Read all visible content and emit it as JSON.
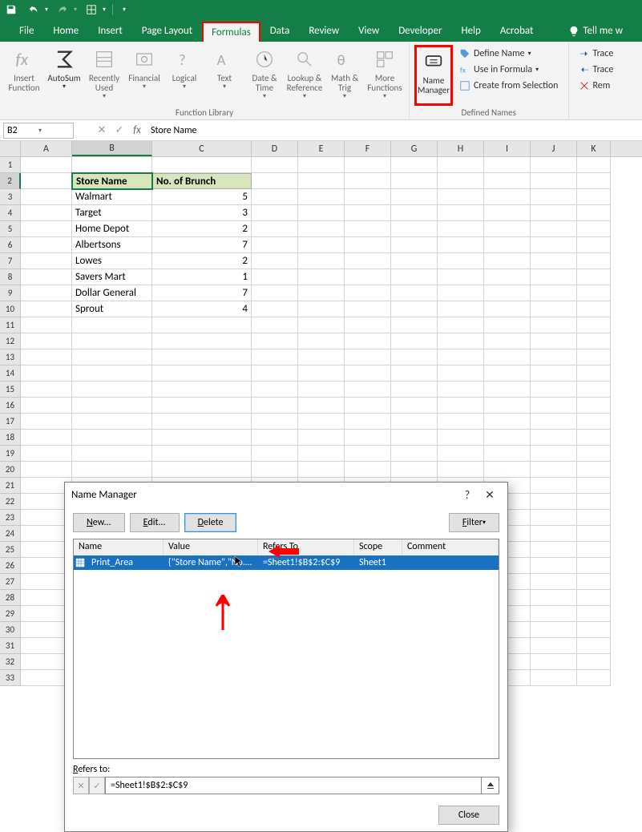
{
  "qat": {
    "save": "save",
    "undo": "undo",
    "redo": "redo",
    "customize": "customize"
  },
  "tabs": [
    "File",
    "Home",
    "Insert",
    "Page Layout",
    "Formulas",
    "Data",
    "Review",
    "View",
    "Developer",
    "Help",
    "Acrobat"
  ],
  "active_tab": "Formulas",
  "tellme": "Tell me w",
  "ribbon": {
    "func_lib_label": "Function Library",
    "insert_function": "Insert\nFunction",
    "autosum": "AutoSum",
    "recently": "Recently\nUsed",
    "financial": "Financial",
    "logical": "Logical",
    "text": "Text",
    "datetime": "Date &\nTime",
    "lookup": "Lookup &\nReference",
    "math": "Math &\nTrig",
    "more": "More\nFunctions",
    "name_manager": "Name\nManager",
    "defined_names_label": "Defined Names",
    "define_name": "Define Name",
    "use_in_formula": "Use in Formula",
    "create_from_selection": "Create from Selection",
    "trace_precedents": "Trace",
    "trace_dependents": "Trace",
    "remove_arrows": "Rem"
  },
  "namebox": "B2",
  "formula_value": "Store Name",
  "columns": [
    "A",
    "B",
    "C",
    "D",
    "E",
    "F",
    "G",
    "H",
    "I",
    "J",
    "K"
  ],
  "rows": [
    1,
    2,
    3,
    4,
    5,
    6,
    7,
    8,
    9,
    10,
    11,
    12,
    13,
    14,
    15,
    16,
    17,
    18,
    19,
    20,
    21,
    22,
    23,
    24,
    25,
    26,
    27,
    28,
    29,
    30,
    31,
    32,
    33
  ],
  "data": {
    "headers": [
      "Store Name",
      "No. of Brunch"
    ],
    "stores": [
      {
        "name": "Walmart",
        "brunch": 5
      },
      {
        "name": "Target",
        "brunch": 3
      },
      {
        "name": "Home Depot",
        "brunch": 2
      },
      {
        "name": "Albertsons",
        "brunch": 7
      },
      {
        "name": "Lowes",
        "brunch": 2
      },
      {
        "name": "Savers Mart",
        "brunch": 1
      },
      {
        "name": "Dollar General",
        "brunch": 7
      },
      {
        "name": "Sprout",
        "brunch": 4
      }
    ]
  },
  "dialog": {
    "title": "Name Manager",
    "new_btn": "New...",
    "edit_btn": "Edit...",
    "delete_btn": "Delete",
    "filter_btn": "Filter",
    "cols": {
      "name": "Name",
      "value": "Value",
      "refers": "Refers To",
      "scope": "Scope",
      "comment": "Comment"
    },
    "row": {
      "name": "Print_Area",
      "value": "{\"Store Name\",\"No. ...",
      "refers": "=Sheet1!$B$2:$C$9",
      "scope": "Sheet1",
      "comment": ""
    },
    "refers_label": "Refers to:",
    "refers_value": "=Sheet1!$B$2:$C$9",
    "close_btn": "Close"
  }
}
